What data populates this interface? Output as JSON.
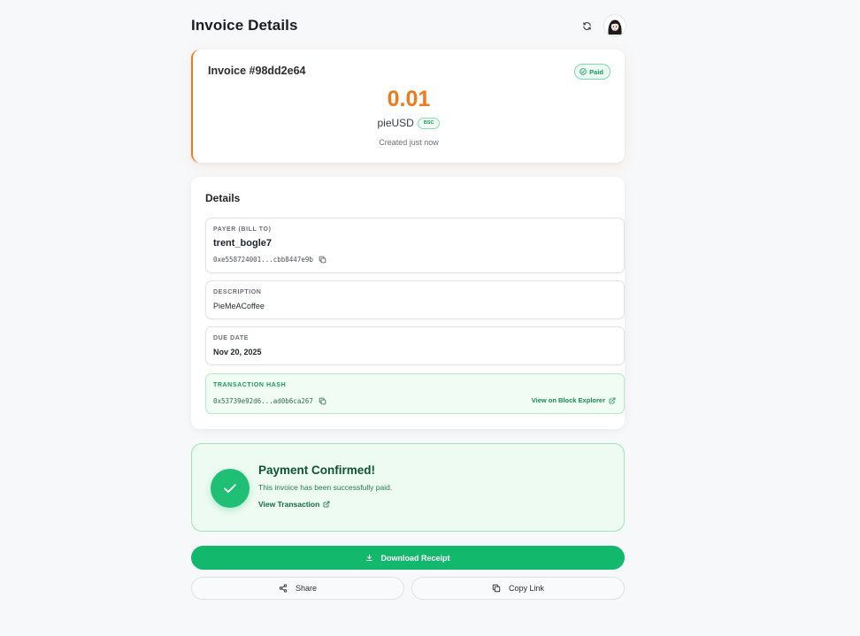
{
  "header": {
    "title": "Invoice Details"
  },
  "invoice": {
    "number": "Invoice #98dd2e64",
    "status": "Paid",
    "amount": "0.01",
    "currency": "pieUSD",
    "chain": "BSC",
    "created": "Created just now"
  },
  "details": {
    "title": "Details",
    "payer": {
      "label": "PAYER (BILL TO)",
      "name": "trent_bogle7",
      "address": "0xe558724001...cbb8447e9b"
    },
    "description": {
      "label": "DESCRIPTION",
      "value": "PieMeACoffee"
    },
    "due_date": {
      "label": "DUE DATE",
      "value": "Nov 20, 2025"
    },
    "transaction": {
      "label": "TRANSACTION HASH",
      "hash": "0x53739e92d6...ad0b6ca267",
      "explorer_link": "View on Block Explorer"
    }
  },
  "confirmation": {
    "title": "Payment Confirmed!",
    "subtitle": "This invoice has been successfully paid.",
    "link": "View Transaction"
  },
  "actions": {
    "download": "Download Receipt",
    "share": "Share",
    "copy_link": "Copy Link"
  },
  "colors": {
    "accent_orange": "#f07a1a",
    "success_green": "#12b86c",
    "page_bg": "#f7f8fa"
  },
  "icons": {
    "refresh": "refresh-icon",
    "paid": "check-circle-icon",
    "copy": "copy-icon",
    "external": "external-link-icon",
    "check": "check-icon",
    "download": "download-icon",
    "share": "share-icon"
  }
}
